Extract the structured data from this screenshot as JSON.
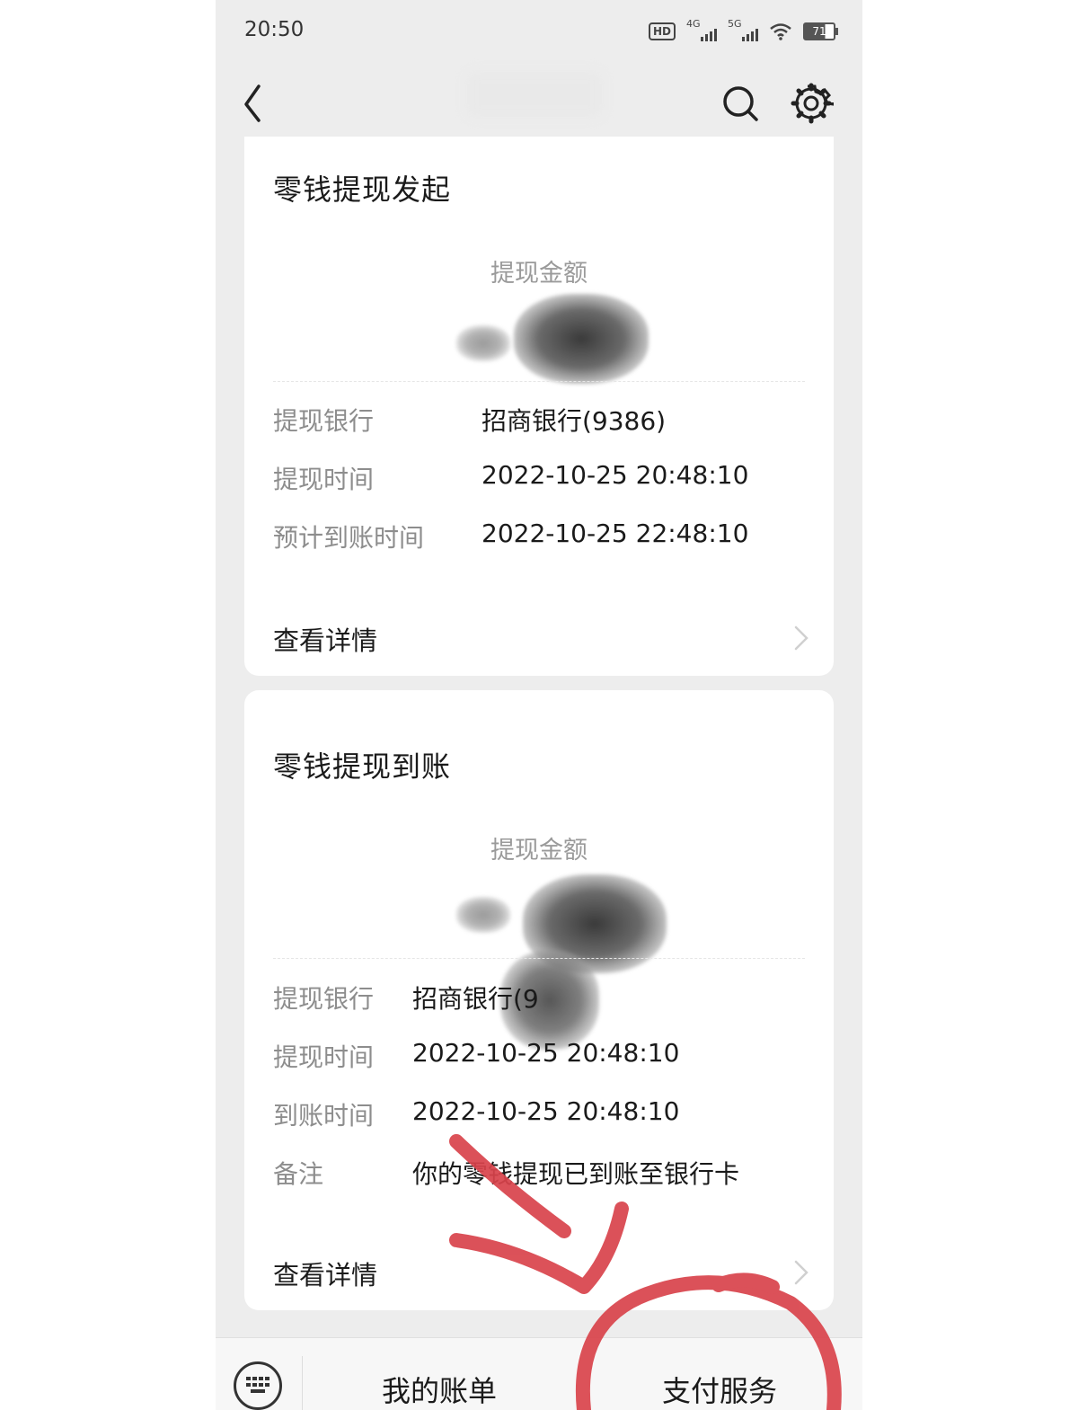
{
  "status_bar": {
    "time": "20:50",
    "hd_badge": "HD",
    "network_1": "4G",
    "network_2": "5G",
    "battery": "71"
  },
  "nav": {
    "back_icon": "chevron-left-icon",
    "search_icon": "search-icon",
    "settings_icon": "gear-icon"
  },
  "cards": [
    {
      "title": "零钱提现发起",
      "amount_label": "提现金额",
      "rows": [
        {
          "key": "提现银行",
          "value": "招商银行(9386)"
        },
        {
          "key": "提现时间",
          "value": "2022-10-25 20:48:10"
        },
        {
          "key": "预计到账时间",
          "value": "2022-10-25 22:48:10"
        }
      ],
      "detail_label": "查看详情"
    },
    {
      "title": "零钱提现到账",
      "amount_label": "提现金额",
      "rows": [
        {
          "key": "提现银行",
          "value": "招商银行(9"
        },
        {
          "key": "提现时间",
          "value": "2022-10-25 20:48:10"
        },
        {
          "key": "到账时间",
          "value": "2022-10-25 20:48:10"
        },
        {
          "key": "备注",
          "value": "你的零钱提现已到账至银行卡"
        }
      ],
      "detail_label": "查看详情"
    }
  ],
  "bottom_bar": {
    "my_bill": "我的账单",
    "pay_service": "支付服务"
  },
  "colors": {
    "annotation_red": "#d9434b",
    "page_bg": "#ededed",
    "card_bg": "#ffffff",
    "key_gray": "#8d8d8d"
  }
}
